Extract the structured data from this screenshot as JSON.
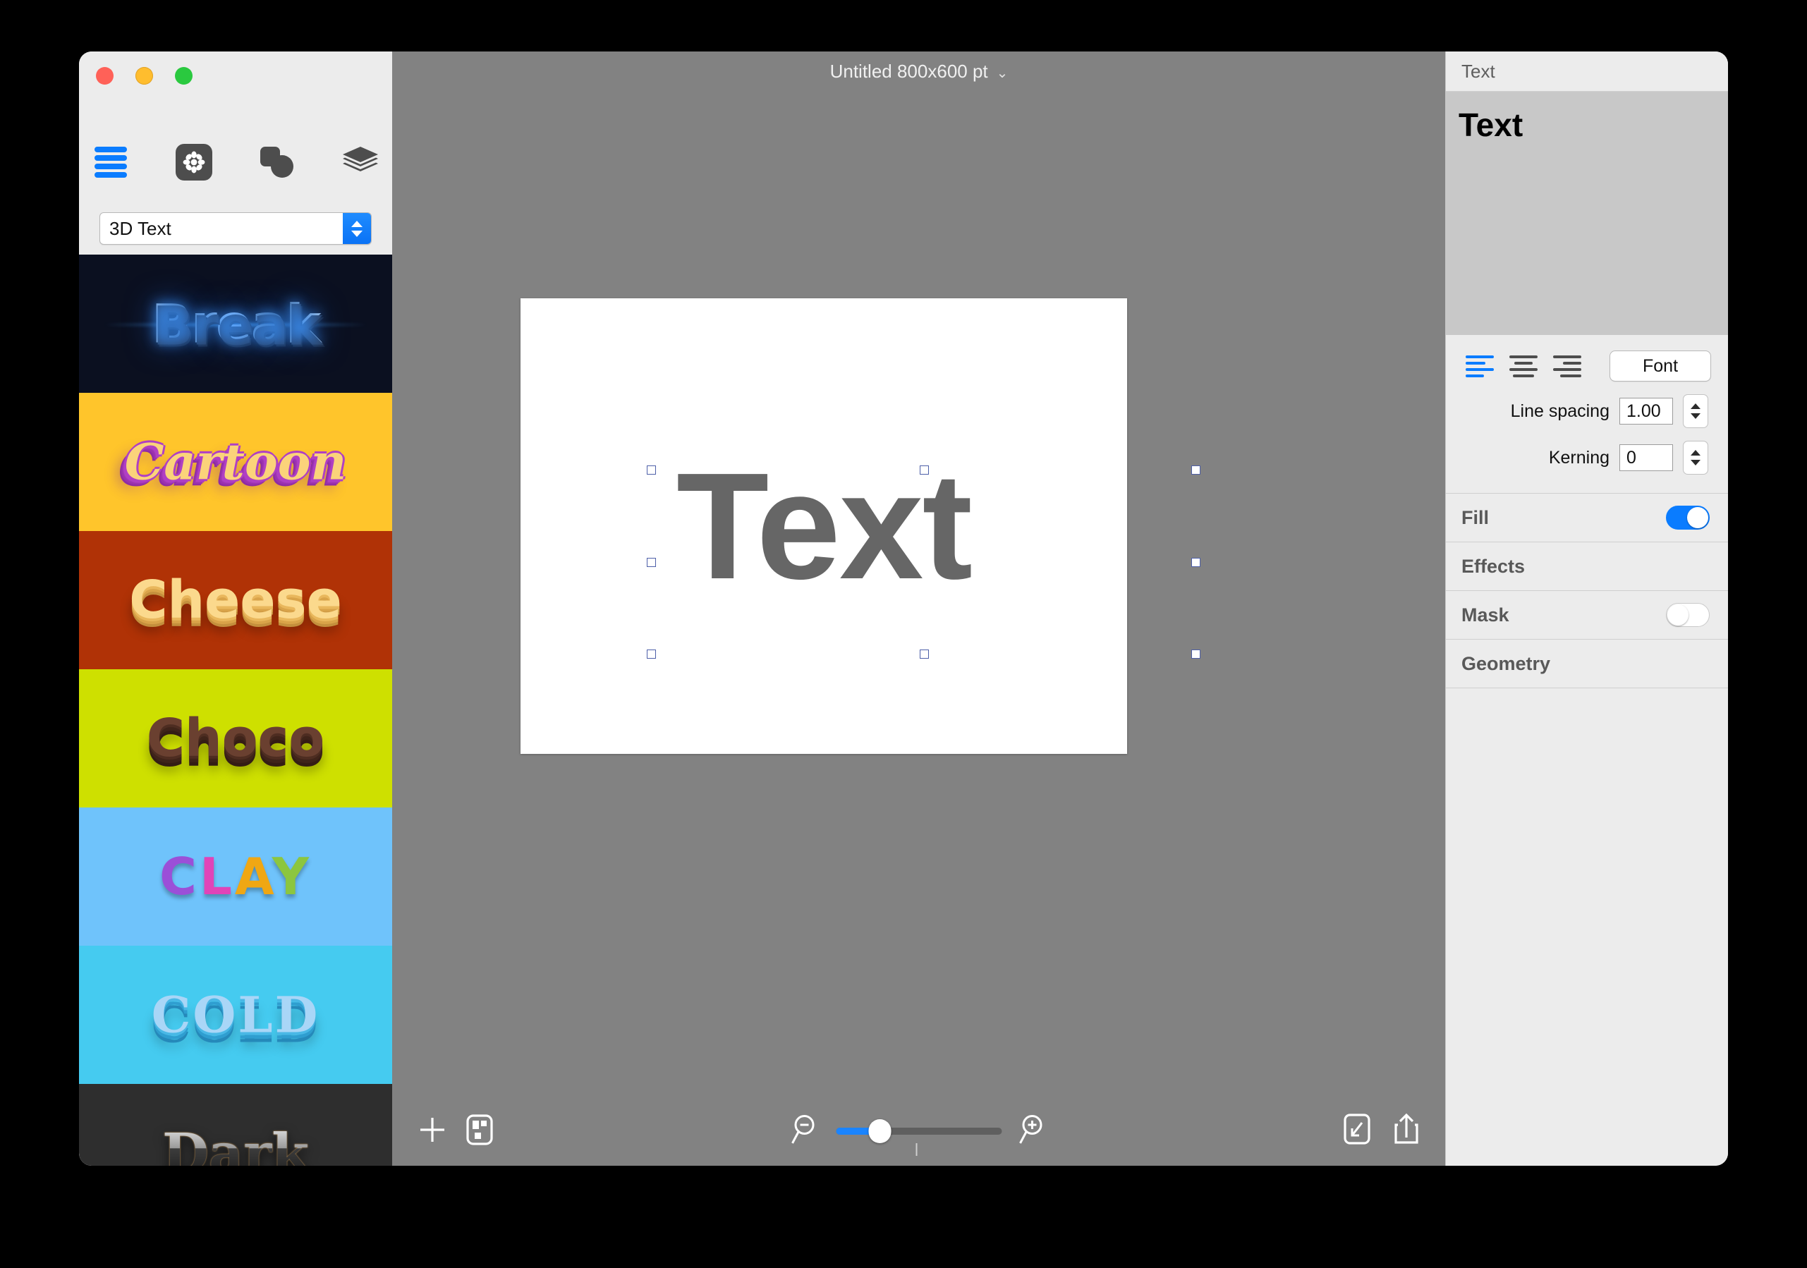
{
  "window": {
    "traffic_lights": [
      "close-red",
      "minimize-yellow",
      "zoom-green"
    ],
    "document_title": "Untitled 800x600 pt",
    "title_caret": "⌄"
  },
  "sidebar": {
    "toolbar_icons": [
      "list-icon",
      "gear-icon",
      "shapes-icon",
      "layers-icon"
    ],
    "preset_select": {
      "value": "3D Text"
    },
    "presets": [
      {
        "name": "Break",
        "label": "Break"
      },
      {
        "name": "Cartoon",
        "label": "Cartoon"
      },
      {
        "name": "Cheese",
        "label": "Cheese"
      },
      {
        "name": "Choco",
        "label": "Choco"
      },
      {
        "name": "Clay",
        "label": "CLAY",
        "letters": [
          "C",
          "L",
          "A",
          "Y"
        ]
      },
      {
        "name": "Cold",
        "label": "COLD"
      },
      {
        "name": "Dark",
        "label": "Dark"
      }
    ]
  },
  "canvas": {
    "text": "Text",
    "selection_handles": 8
  },
  "bottom_bar": {
    "add_label": "add-icon",
    "arrange_label": "arrange-icon",
    "zoom_out_label": "zoom-out-icon",
    "zoom_in_label": "zoom-in-icon",
    "fit_label": "fit-icon",
    "share_label": "share-icon",
    "zoom_value": 25
  },
  "inspector": {
    "header": "Text",
    "preview_value": "Text",
    "alignment": {
      "options": [
        "align-left",
        "align-center",
        "align-right"
      ],
      "selected": "align-left"
    },
    "font_button": "Font",
    "line_spacing": {
      "label": "Line spacing",
      "value": "1.00"
    },
    "kerning": {
      "label": "Kerning",
      "value": "0"
    },
    "sections": [
      {
        "label": "Fill",
        "toggle": "on"
      },
      {
        "label": "Effects",
        "toggle": null
      },
      {
        "label": "Mask",
        "toggle": "off"
      },
      {
        "label": "Geometry",
        "toggle": null
      }
    ]
  },
  "colors": {
    "accent": "#0a7cff",
    "canvas_bg": "#828282",
    "panel_bg": "#ececec"
  }
}
